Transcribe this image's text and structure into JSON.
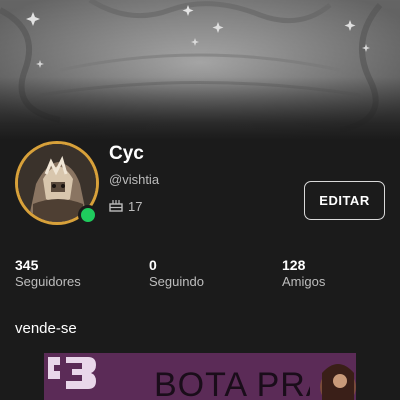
{
  "profile": {
    "display_name": "Cyc",
    "username": "@vishtia",
    "account_age": "17",
    "online_status": "online",
    "status_color": "#1fcb5d",
    "avatar_ring_color": "#d8a13a"
  },
  "actions": {
    "edit_label": "EDITAR"
  },
  "stats": {
    "followers": {
      "count": "345",
      "label": "Seguidores"
    },
    "following": {
      "count": "0",
      "label": "Seguindo"
    },
    "friends": {
      "count": "128",
      "label": "Amigos"
    }
  },
  "section": {
    "title": "vende-se"
  },
  "promo": {
    "title": "BOTA PRA"
  },
  "icons": {
    "age": "cake-icon",
    "status": "online-status-icon"
  }
}
